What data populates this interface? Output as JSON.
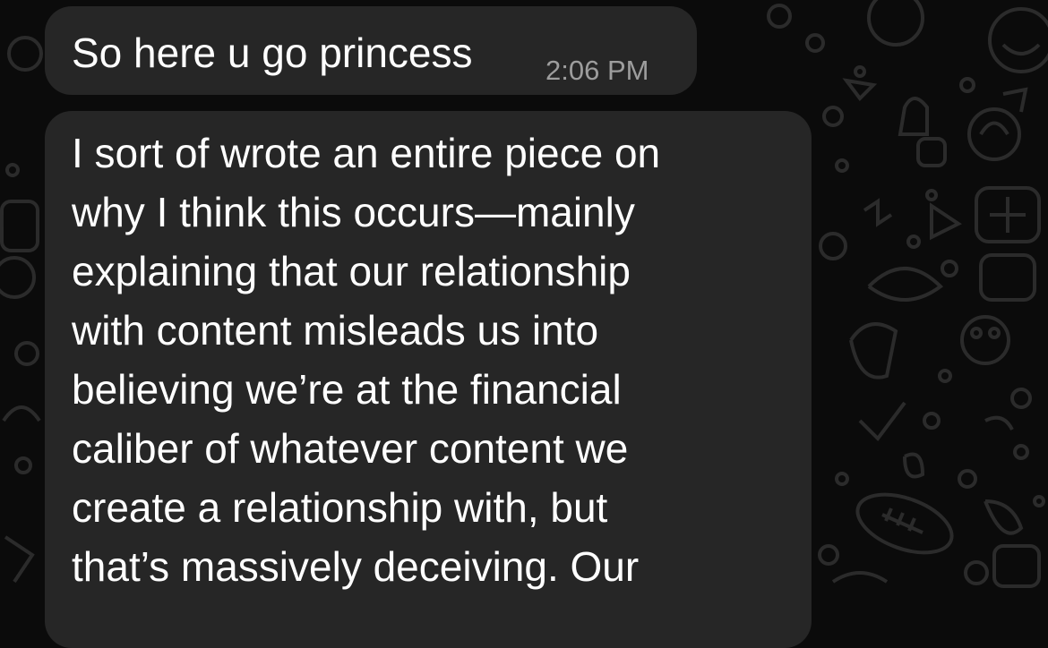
{
  "chat": {
    "messages": [
      {
        "text": "So here u go princess",
        "time": "2:06 PM"
      },
      {
        "lines": [
          "I sort of wrote an entire piece on",
          "why I think this occurs—mainly",
          "explaining that our relationship",
          "with content misleads us into",
          "believing we’re at the financial",
          "caliber of whatever content we",
          "create a relationship with, but",
          "that’s massively deceiving. Our"
        ]
      }
    ]
  },
  "colors": {
    "background": "#0b0b0b",
    "bubble": "#262626",
    "text": "#ffffff",
    "timestamp": "#9d9d9d",
    "doodle": "#2a2a2a"
  }
}
